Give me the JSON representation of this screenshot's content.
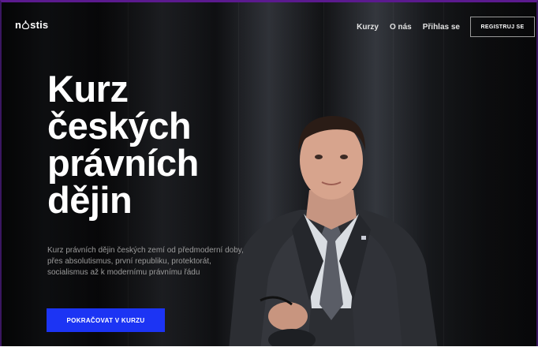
{
  "brand": {
    "logo_text_start": "n",
    "logo_text_end": "stis"
  },
  "nav": {
    "links": [
      {
        "label": "Kurzy"
      },
      {
        "label": "O nás"
      },
      {
        "label": "Přihlas se"
      }
    ],
    "register_label": "REGISTRUJ SE"
  },
  "hero": {
    "title_lines": [
      "Kurz",
      "českých",
      "právních",
      "dějin"
    ],
    "subtitle": "Kurz právních dějin českých zemí od předmoderní doby, přes absolutismus, první republiku, protektorát, socialismus až k modernímu právnímu řádu",
    "cta_label": "POKRAČOVAT V KURZU"
  },
  "colors": {
    "accent": "#1c34f4",
    "frame": "#5b1a8e",
    "background": "#0c0c0e",
    "text": "#ffffff",
    "subtitle_text": "#9b9b9b"
  },
  "icons": {
    "logo": "drop-logo-icon",
    "photo": "man-in-suit-photo"
  }
}
